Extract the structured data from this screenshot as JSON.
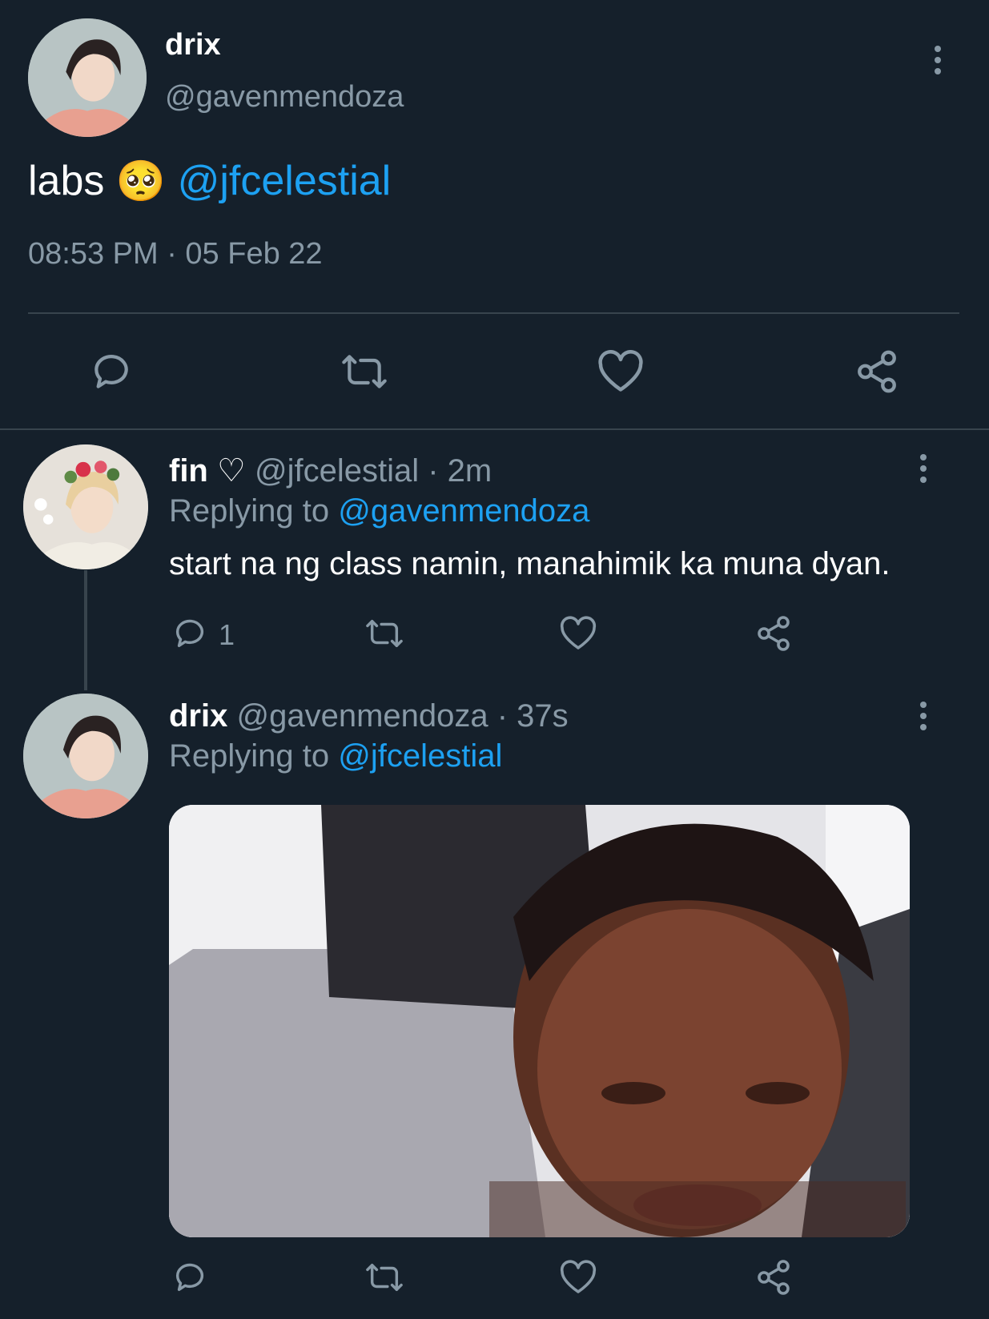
{
  "main_tweet": {
    "display_name": "drix",
    "handle": "@gavenmendoza",
    "text": "labs",
    "emoji": "🥺",
    "mention": "@jfcelestial",
    "timestamp": "08:53 PM · 05 Feb 22"
  },
  "reply1": {
    "display_name": "fin",
    "heart": "♡",
    "handle": "@jfcelestial",
    "time": "· 2m",
    "replying_prefix": "Replying to",
    "replying_to": "@gavenmendoza",
    "text": "start na ng class namin, manahimik ka muna dyan.",
    "reply_count": "1"
  },
  "reply2": {
    "display_name": "drix",
    "handle": "@gavenmendoza",
    "time": "· 37s",
    "replying_prefix": "Replying to",
    "replying_to": "@jfcelestial"
  },
  "icons": [
    "reply-icon",
    "retweet-icon",
    "like-icon",
    "share-icon",
    "more-icon"
  ],
  "colors": {
    "background": "#15202b",
    "muted": "#8899a6",
    "link": "#1da1f2",
    "divider": "#38444d"
  }
}
